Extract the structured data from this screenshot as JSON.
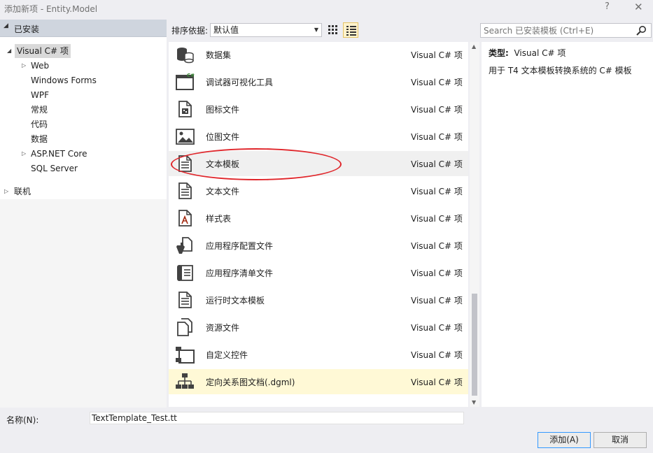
{
  "window": {
    "title": "添加新项 - Entity.Model",
    "help": "?",
    "close": "✕"
  },
  "left": {
    "installed_label": "已安装",
    "tree": [
      {
        "label": "Visual C# 项",
        "expanded": true,
        "selected": true
      },
      {
        "label": "Web",
        "has_children": true
      },
      {
        "label": "Windows Forms"
      },
      {
        "label": "WPF"
      },
      {
        "label": "常规"
      },
      {
        "label": "代码"
      },
      {
        "label": "数据"
      },
      {
        "label": "ASP.NET Core",
        "has_children": true
      },
      {
        "label": "SQL Server"
      }
    ],
    "online_label": "联机"
  },
  "toolbar": {
    "sort_label": "排序依据:",
    "sort_value": "默认值",
    "search_placeholder": "Search 已安装模板 (Ctrl+E)"
  },
  "items": [
    {
      "name": "数据集",
      "lang": "Visual C# 项",
      "icon": "dataset-icon"
    },
    {
      "name": "调试器可视化工具",
      "lang": "Visual C# 项",
      "icon": "visualizer-icon"
    },
    {
      "name": "图标文件",
      "lang": "Visual C# 项",
      "icon": "icon-file-icon"
    },
    {
      "name": "位图文件",
      "lang": "Visual C# 项",
      "icon": "bitmap-icon"
    },
    {
      "name": "文本模板",
      "lang": "Visual C# 项",
      "icon": "text-template-icon"
    },
    {
      "name": "文本文件",
      "lang": "Visual C# 项",
      "icon": "text-file-icon"
    },
    {
      "name": "样式表",
      "lang": "Visual C# 项",
      "icon": "stylesheet-icon"
    },
    {
      "name": "应用程序配置文件",
      "lang": "Visual C# 项",
      "icon": "config-file-icon"
    },
    {
      "name": "应用程序清单文件",
      "lang": "Visual C# 项",
      "icon": "manifest-icon"
    },
    {
      "name": "运行时文本模板",
      "lang": "Visual C# 项",
      "icon": "runtime-template-icon"
    },
    {
      "name": "资源文件",
      "lang": "Visual C# 项",
      "icon": "resource-file-icon"
    },
    {
      "name": "自定义控件",
      "lang": "Visual C# 项",
      "icon": "custom-control-icon"
    },
    {
      "name": "定向关系图文档(.dgml)",
      "lang": "Visual C# 项",
      "icon": "dgml-icon"
    }
  ],
  "details": {
    "type_label": "类型:",
    "type_value": "Visual C# 项",
    "description": "用于 T4 文本模板转换系统的 C# 模板"
  },
  "bottom": {
    "name_label": "名称(N):",
    "name_value": "TextTemplate_Test.tt",
    "add_button": "添加(A)",
    "cancel_button": "取消"
  },
  "colors": {
    "annotation_ellipse": "#e0262b",
    "selected_row": "#fff9d6",
    "hover_row": "#f0f0f0",
    "tree_selected": "#d9d9d9",
    "header_band": "#cfd5de"
  }
}
